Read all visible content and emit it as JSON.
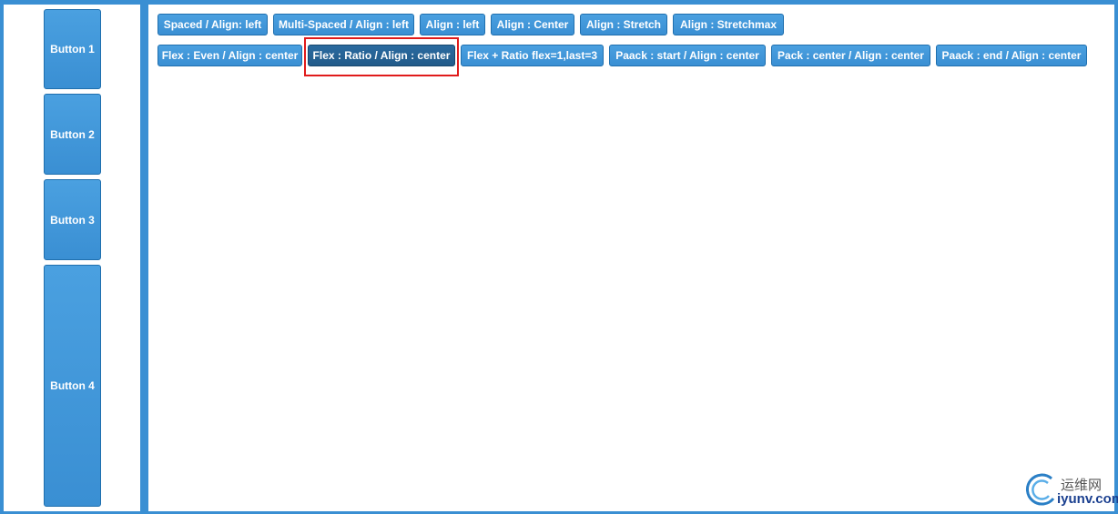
{
  "left_buttons": [
    {
      "label": "Button 1"
    },
    {
      "label": "Button 2"
    },
    {
      "label": "Button 3"
    },
    {
      "label": "Button 4"
    }
  ],
  "row1_buttons": [
    {
      "label": "Spaced / Align: left"
    },
    {
      "label": "Multi-Spaced / Align : left"
    },
    {
      "label": "Align : left"
    },
    {
      "label": "Align : Center"
    },
    {
      "label": "Align : Stretch"
    },
    {
      "label": "Align : Stretchmax"
    }
  ],
  "row2_buttons": [
    {
      "label": "Flex : Even / Align : center"
    },
    {
      "label": "Flex : Ratio / Align : center",
      "active": true
    },
    {
      "label": "Flex + Ratio flex=1,last=3"
    },
    {
      "label": "Paack : start / Align : center"
    },
    {
      "label": "Pack : center / Align : center"
    },
    {
      "label": "Paack : end / Align : center"
    }
  ],
  "watermark": {
    "top_text": "运维网",
    "bottom_text": "iyunv.com"
  },
  "colors": {
    "frame_blue": "#3a8fd3",
    "button_blue": "#3a8fd3",
    "active_button": "#225b8a",
    "highlight_red": "#e01b1b"
  }
}
